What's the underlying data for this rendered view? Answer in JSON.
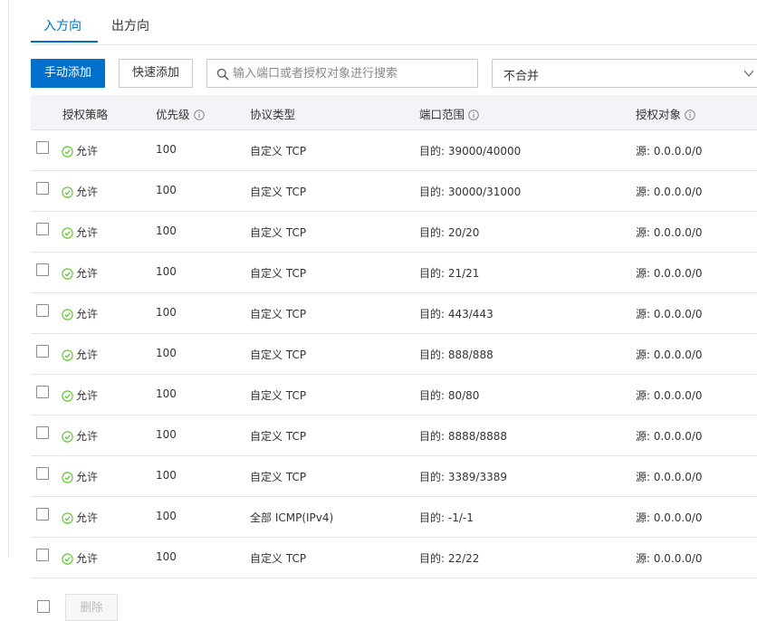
{
  "tabs": {
    "inbound": "入方向",
    "outbound": "出方向"
  },
  "toolbar": {
    "manual_add": "手动添加",
    "quick_add": "快速添加",
    "search_placeholder": "输入端口或者授权对象进行搜索",
    "merge_select": "不合并"
  },
  "columns": {
    "policy": "授权策略",
    "priority": "优先级",
    "protocol": "协议类型",
    "port_range": "端口范围",
    "auth_object": "授权对象"
  },
  "rows": [
    {
      "policy": "允许",
      "priority": "100",
      "protocol": "自定义 TCP",
      "port": "目的: 39000/40000",
      "object": "源: 0.0.0.0/0"
    },
    {
      "policy": "允许",
      "priority": "100",
      "protocol": "自定义 TCP",
      "port": "目的: 30000/31000",
      "object": "源: 0.0.0.0/0"
    },
    {
      "policy": "允许",
      "priority": "100",
      "protocol": "自定义 TCP",
      "port": "目的: 20/20",
      "object": "源: 0.0.0.0/0"
    },
    {
      "policy": "允许",
      "priority": "100",
      "protocol": "自定义 TCP",
      "port": "目的: 21/21",
      "object": "源: 0.0.0.0/0"
    },
    {
      "policy": "允许",
      "priority": "100",
      "protocol": "自定义 TCP",
      "port": "目的: 443/443",
      "object": "源: 0.0.0.0/0"
    },
    {
      "policy": "允许",
      "priority": "100",
      "protocol": "自定义 TCP",
      "port": "目的: 888/888",
      "object": "源: 0.0.0.0/0"
    },
    {
      "policy": "允许",
      "priority": "100",
      "protocol": "自定义 TCP",
      "port": "目的: 80/80",
      "object": "源: 0.0.0.0/0"
    },
    {
      "policy": "允许",
      "priority": "100",
      "protocol": "自定义 TCP",
      "port": "目的: 8888/8888",
      "object": "源: 0.0.0.0/0"
    },
    {
      "policy": "允许",
      "priority": "100",
      "protocol": "自定义 TCP",
      "port": "目的: 3389/3389",
      "object": "源: 0.0.0.0/0"
    },
    {
      "policy": "允许",
      "priority": "100",
      "protocol": "全部 ICMP(IPv4)",
      "port": "目的: -1/-1",
      "object": "源: 0.0.0.0/0"
    },
    {
      "policy": "允许",
      "priority": "100",
      "protocol": "自定义 TCP",
      "port": "目的: 22/22",
      "object": "源: 0.0.0.0/0"
    }
  ],
  "footer": {
    "delete": "删除"
  },
  "colors": {
    "accent": "#0070cc",
    "allow": "#52c41a",
    "header_bg": "#f2f4f7"
  },
  "icons": {
    "search": "search-icon",
    "info": "info-icon",
    "allow": "check-circle-icon",
    "dropdown": "chevron-down-icon"
  }
}
